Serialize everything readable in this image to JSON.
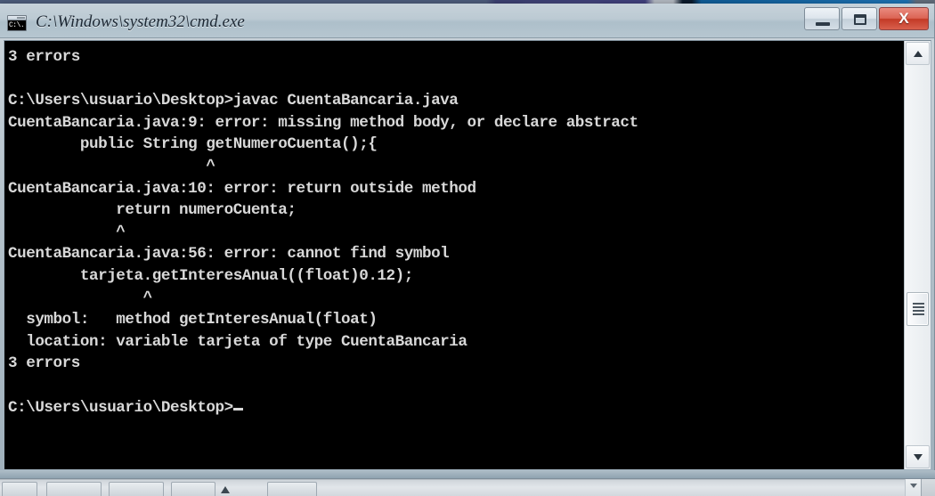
{
  "window": {
    "title": "C:\\Windows\\system32\\cmd.exe",
    "icon_name": "cmd-icon",
    "icon_text": "C:\\.",
    "controls": {
      "minimize_label": "–",
      "maximize_label": "□",
      "close_label": "X"
    }
  },
  "console": {
    "background_color": "#000000",
    "foreground_color": "#d8d8d8",
    "lines": [
      "3 errors",
      "",
      "C:\\Users\\usuario\\Desktop>javac CuentaBancaria.java",
      "CuentaBancaria.java:9: error: missing method body, or declare abstract",
      "        public String getNumeroCuenta();{",
      "                      ^",
      "CuentaBancaria.java:10: error: return outside method",
      "            return numeroCuenta;",
      "            ^",
      "CuentaBancaria.java:56: error: cannot find symbol",
      "        tarjeta.getInteresAnual((float)0.12);",
      "               ^",
      "  symbol:   method getInteresAnual(float)",
      "  location: variable tarjeta of type CuentaBancaria",
      "3 errors",
      ""
    ],
    "prompt": "C:\\Users\\usuario\\Desktop>",
    "error_count": "3 errors",
    "command": "javac CuentaBancaria.java"
  },
  "scrollbar": {
    "up_arrow": "▲",
    "down_arrow": "▼",
    "thumb_position_percent": 66
  },
  "taskbar": {
    "scroll_arrow": "▼"
  }
}
